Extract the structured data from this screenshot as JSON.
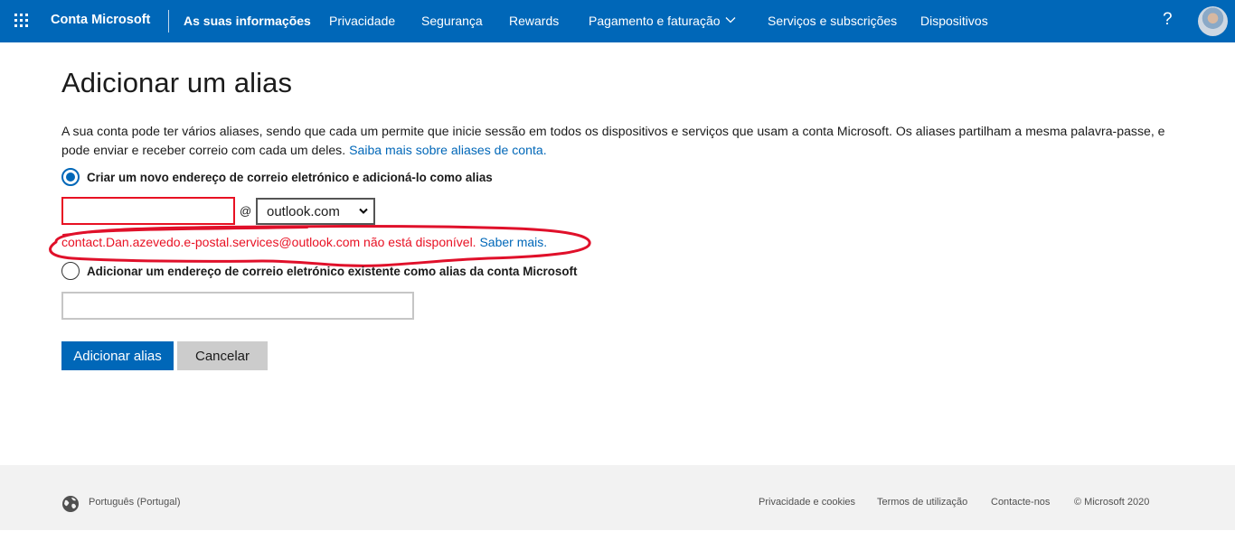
{
  "header": {
    "brand": "Conta Microsoft",
    "nav": [
      {
        "label": "As suas informações",
        "active": true
      },
      {
        "label": "Privacidade"
      },
      {
        "label": "Segurança"
      },
      {
        "label": "Rewards"
      },
      {
        "label": "Pagamento e faturação"
      },
      {
        "label": "Serviços e subscrições"
      },
      {
        "label": "Dispositivos"
      }
    ],
    "help": "?"
  },
  "main": {
    "title": "Adicionar um alias",
    "description": "A sua conta pode ter vários aliases, sendo que cada um permite que inicie sessão em todos os dispositivos e serviços que usam a conta Microsoft. Os aliases partilham a mesma palavra-passe, e pode enviar e receber correio com cada um deles.",
    "learn_more_link": "Saiba mais sobre aliases de conta.",
    "option_new": {
      "label": "Criar um novo endereço de correio eletrónico e adicioná-lo como alias",
      "selected": true,
      "input_value": "",
      "at": "@",
      "domain_selected": "outlook.com",
      "error_text": "contact.Dan.azevedo.e-postal.services@outlook.com não está disponível.",
      "error_link": "Saber mais."
    },
    "option_existing": {
      "label": "Adicionar um endereço de correio eletrónico existente como alias da conta Microsoft",
      "selected": false,
      "input_value": ""
    },
    "buttons": {
      "add": "Adicionar alias",
      "cancel": "Cancelar"
    }
  },
  "footer": {
    "language": "Português (Portugal)",
    "links": [
      "Privacidade e cookies",
      "Termos de utilização",
      "Contacte-nos"
    ],
    "copyright": "© Microsoft 2020"
  },
  "colors": {
    "brand_blue": "#0067b8",
    "error_red": "#e81123",
    "annotation_red": "#e0102a"
  }
}
